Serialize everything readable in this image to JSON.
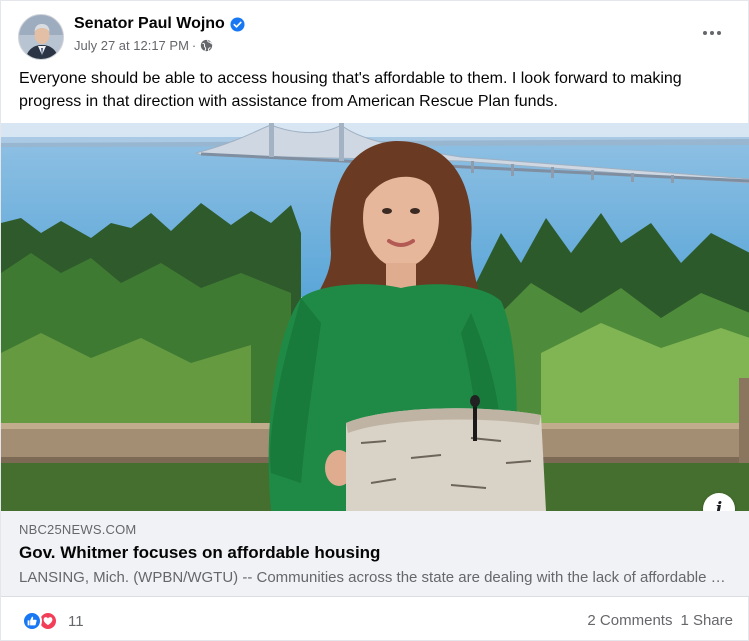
{
  "post": {
    "author": "Senator Paul Wojno",
    "timestamp": "July 27 at 12:17 PM",
    "separator": "·",
    "privacy_icon": "globe-icon",
    "verified_icon": "verified-badge-icon",
    "text": "Everyone should be able to access housing that's affordable to them. I look forward to making progress in that direction with assistance from American Rescue Plan funds."
  },
  "link_preview": {
    "domain": "NBC25NEWS.COM",
    "title": "Gov. Whitmer focuses on affordable housing",
    "description": "LANSING, Mich. (WPBN/WGTU) -- Communities across the state are dealing with the lack of affordable housing",
    "info_icon": "i"
  },
  "footer": {
    "reaction_icons": [
      "like-icon",
      "love-icon"
    ],
    "reaction_count": "11",
    "comments": "2 Comments",
    "shares": "1 Share"
  },
  "colors": {
    "accent": "#1877f2",
    "love": "#f33e58",
    "secondary_text": "#65676b",
    "link_bg": "#f0f2f5"
  }
}
